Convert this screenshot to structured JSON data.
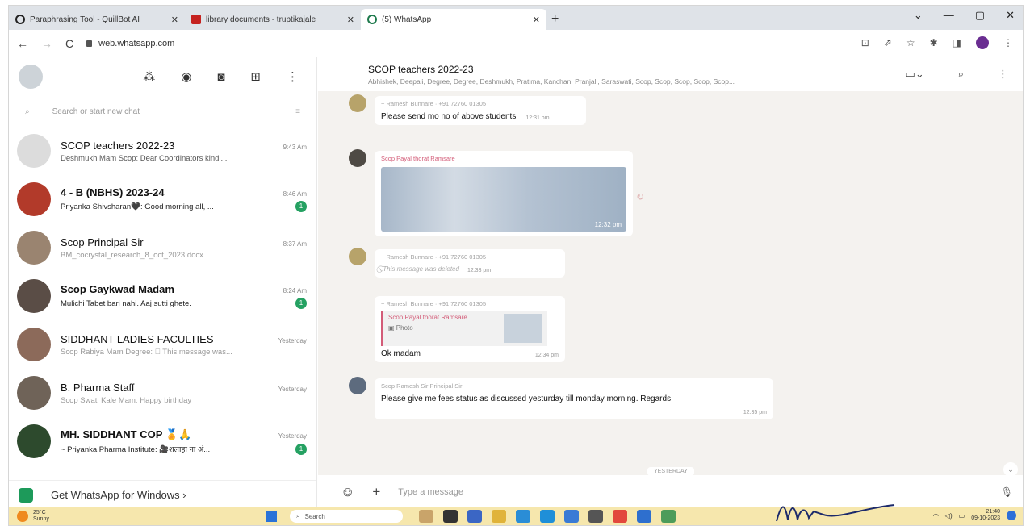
{
  "browser": {
    "tabs": [
      {
        "title": "Paraphrasing Tool - QuillBot AI",
        "icon": "quillbot-icon"
      },
      {
        "title": "library documents - truptikajale",
        "icon": "gmail-icon"
      },
      {
        "title": "(5) WhatsApp",
        "icon": "whatsapp-icon"
      }
    ],
    "new_tab": "+",
    "url": "web.whatsapp.com"
  },
  "sidebar": {
    "search_placeholder": "Search or start new chat",
    "chats": [
      {
        "name": "SCOP teachers 2022-23",
        "time": "9:43 Am",
        "preview": "Deshmukh Mam Scop: Dear Coordinators kindl...",
        "badge": "",
        "avatar": "#dcdcdc",
        "bold": false,
        "faint": false
      },
      {
        "name": "4 - B (NBHS) 2023-24",
        "time": "8:46 Am",
        "preview": "Priyanka Shivsharan🖤: Good morning all, ...",
        "badge": "1",
        "avatar": "#b23a2a",
        "bold": true,
        "faint": false
      },
      {
        "name": "Scop Principal Sir",
        "time": "8:37 Am",
        "preview": "BM_cocrystal_research_8_oct_2023.docx",
        "badge": "",
        "avatar": "#9a8470",
        "bold": false,
        "faint": true
      },
      {
        "name": "Scop Gaykwad Madam",
        "time": "8:24 Am",
        "preview": "Mulichi Tabet bari nahi. Aaj sutti ghete.",
        "badge": "1",
        "avatar": "#5a4d46",
        "bold": true,
        "faint": false
      },
      {
        "name": "SIDDHANT LADIES FACULTIES",
        "time": "Yesterday",
        "preview": "Scop Rabiya Mam Degree: ⃠ This message was...",
        "badge": "",
        "avatar": "#8c6a5a",
        "bold": false,
        "faint": true
      },
      {
        "name": "B. Pharma Staff",
        "time": "Yesterday",
        "preview": "Scop Swati Kale Mam: Happy birthday",
        "badge": "",
        "avatar": "#6f6358",
        "bold": false,
        "faint": true
      },
      {
        "name": "MH. SIDDHANT COP 🏅🙏",
        "time": "Yesterday",
        "preview": "~ Priyanka Pharma Institute: 🎥शलाहा ना अं...",
        "badge": "1",
        "avatar": "#2d4a2d",
        "bold": true,
        "faint": false
      }
    ],
    "get_app": "Get WhatsApp for Windows ›"
  },
  "conversation": {
    "title": "SCOP teachers 2022-23",
    "members": "Abhishek, Deepali, Degree, Degree, Deshmukh, Pratima, Kanchan, Pranjali, Saraswati, Scop, Scop, Scop, Scop, Scop...",
    "messages": [
      {
        "sender": "~ Ramesh Bunnare · +91 72760 01305",
        "text": "Please send mo no of above students",
        "time": "12:31 pm"
      },
      {
        "sender": "Scop Payal thorat Ramsare",
        "photo_time": "12:32 pm"
      },
      {
        "sender": "~ Ramesh Bunnare · +91 72760 01305",
        "deleted": "This message was deleted",
        "time": "12:33 pm"
      },
      {
        "sender": "~ Ramesh Bunnare · +91 72760 01305",
        "quote_name": "Scop Payal thorat Ramsare",
        "quote_type": "Photo",
        "text": "Ok madam",
        "time": "12:34 pm"
      },
      {
        "sender": "Scop Ramesh Sir Principal Sir",
        "text": "Please give me fees status as discussed yesturday till monday morning. Regards",
        "time": "12:35 pm"
      }
    ],
    "day_divider": "YESTERDAY",
    "composer_placeholder": "Type a message"
  },
  "taskbar": {
    "temp": "25°C",
    "condition": "Sunny",
    "search": "Search",
    "time": "21:40",
    "date": "09-10-2023"
  },
  "colors": {
    "tabbar": "#dfe3e8",
    "accent": "#25a162",
    "chat_bg": "#f4f2ef",
    "taskbar": "#f6e7ad",
    "sender_pink": "#d35c78"
  }
}
